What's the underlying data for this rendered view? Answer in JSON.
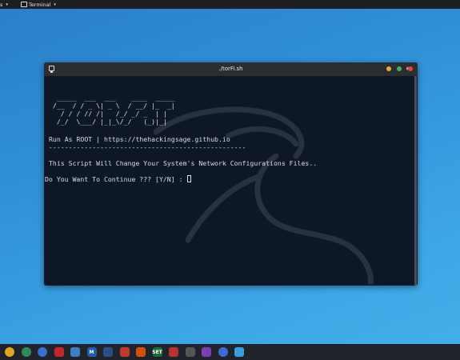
{
  "top_panel": {
    "menu1_label": "s",
    "menu2_label": "Terminal"
  },
  "window": {
    "title": "./torFi.sh"
  },
  "terminal": {
    "banner": [
      "  _____  ___  ___    ____  _____",
      " /__  / / _ \\| _ \\  / __/ |_  _|",
      "   / / / // /|   /_/ _/ _  | |",
      "  /_/  \\___/ |_|_\\/_/   (_)|_|"
    ],
    "run_as_root": "Run As ROOT | https://thehackingsage.github.io",
    "separator": "--------------------------------------------------",
    "warning": "This Script Will Change Your System's Network Configurations Files..",
    "prompt": "Do You Want To Continue ??? [Y/N] : "
  },
  "dock": {
    "icons": [
      {
        "name": "chrome-icon",
        "label": "",
        "color": "#e0a322"
      },
      {
        "name": "chromium-icon",
        "label": "",
        "color": "#2e8b57"
      },
      {
        "name": "eye-icon",
        "label": "",
        "color": "#3a6fd0"
      },
      {
        "name": "red-tool-icon",
        "label": "",
        "color": "#c1272d"
      },
      {
        "name": "metasploit-icon",
        "label": "",
        "color": "#3a7fc0"
      },
      {
        "name": "maltego-icon",
        "label": "M",
        "color": "#1f5fa8"
      },
      {
        "name": "dragon-icon",
        "label": "",
        "color": "#2b4f8a"
      },
      {
        "name": "burp-icon",
        "label": "",
        "color": "#c0392b"
      },
      {
        "name": "sqlmap-icon",
        "label": "",
        "color": "#d35400"
      },
      {
        "name": "set-icon",
        "label": "SET",
        "color": "#1e6b3a"
      },
      {
        "name": "target-icon",
        "label": "",
        "color": "#b83232"
      },
      {
        "name": "cross-icon",
        "label": "",
        "color": "#555"
      },
      {
        "name": "screen-icon",
        "label": "",
        "color": "#7a3fb0"
      },
      {
        "name": "settings-gear-icon",
        "label": "",
        "color": "#3b6bd6"
      },
      {
        "name": "apps-grid-icon",
        "label": "",
        "color": "#3b9fdf"
      }
    ]
  }
}
